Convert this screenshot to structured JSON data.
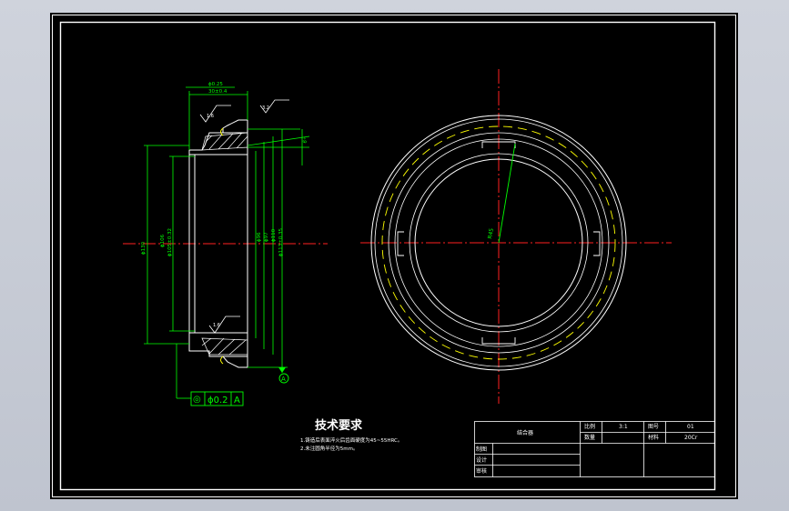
{
  "drawing": {
    "notes_title": "技术要求",
    "notes": [
      "1.铸造后表面淬火后齿面硬度为45~55HRC。",
      "2.未注圆角半径为5mm。"
    ],
    "datum_label": "A",
    "tolerance_frame": {
      "symbol": "◎",
      "value": "ϕ0.2",
      "datum": "A"
    },
    "dims": {
      "top_tol": "ϕ0.25",
      "top_width": "30±0.4",
      "rough_left": "1.6",
      "rough_right": "3.2",
      "rough_bottom": "1.6",
      "angle": "6°",
      "left_overall": "ϕ130",
      "left_bore_a": "ϕ106",
      "left_bore_b": "ϕ105±0.32",
      "right_d1": "ϕ96",
      "right_d2": "ϕ97",
      "right_d3": "ϕ110",
      "right_d4": "ϕ113±0.35",
      "radius": "R45"
    },
    "title_block": {
      "part_name": "结合器",
      "scale_label": "比例",
      "scale_value": "3:1",
      "drawing_no_label": "图号",
      "drawing_no_value": "01",
      "qty_label": "数量",
      "material_label": "材料",
      "material_value": "20Cr",
      "drawn_label": "制图",
      "design_label": "设计",
      "review_label": "审核"
    }
  },
  "colors": {
    "background": "#000000",
    "frame": "#ffffff",
    "centerline": "#ff2020",
    "dimension": "#00ff00",
    "outline": "#ffffff",
    "thread": "#ffff00",
    "hatch": "#ffffff"
  }
}
